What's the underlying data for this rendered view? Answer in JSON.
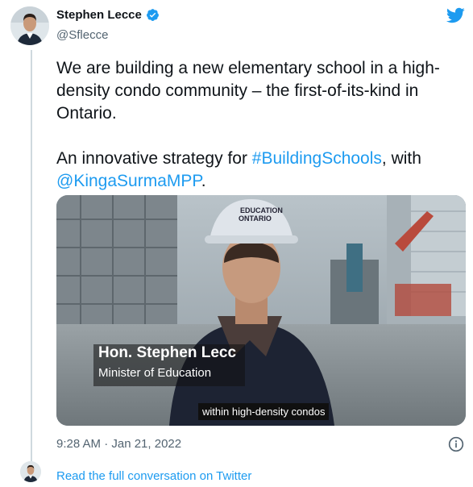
{
  "author": {
    "name": "Stephen Lecce",
    "handle": "@Sflecce",
    "verified": true
  },
  "tweet": {
    "line1": "We are building a new elementary school in a high-density condo community – the first-of-its-kind in Ontario.",
    "line2_prefix": "An innovative strategy for ",
    "hashtag": "#BuildingSchools",
    "line2_middle": ", with",
    "mention": "@KingaSurmaMPP",
    "line2_suffix": "."
  },
  "media": {
    "caption_name": "Hon. Stephen Lecc",
    "caption_role": "Minister of Education",
    "subtitle": "within high-density condos",
    "helmet_text": "EDUCATION ONTARIO"
  },
  "footer": {
    "timestamp": "9:28 AM · Jan 21, 2022",
    "read_more": "Read the full conversation on Twitter"
  },
  "colors": {
    "link": "#1d9bf0",
    "secondary_text": "#536471",
    "thread_line": "#cfd9de"
  },
  "icons": {
    "brand": "twitter-bird-icon",
    "verified": "verified-badge-icon",
    "info": "info-icon"
  }
}
